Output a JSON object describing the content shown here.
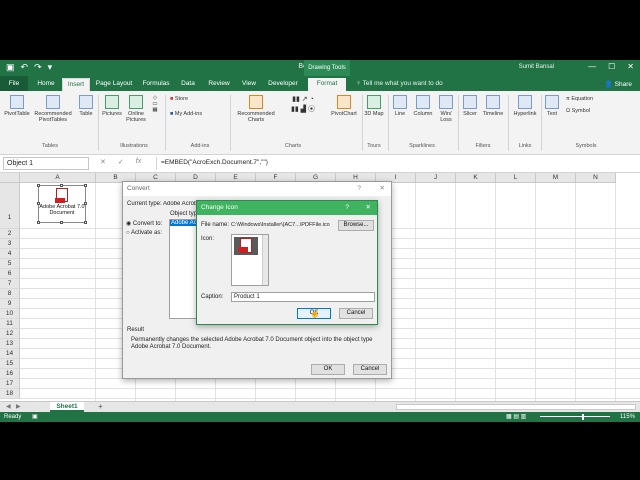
{
  "window": {
    "title": "Book1 - Excel",
    "drawing_tools": "Drawing Tools",
    "user": "Sumit Bansal",
    "controls": [
      "—",
      "☐",
      "✕"
    ]
  },
  "tabs": {
    "file": "File",
    "home": "Home",
    "insert": "Insert",
    "page_layout": "Page Layout",
    "formulas": "Formulas",
    "data": "Data",
    "review": "Review",
    "view": "View",
    "developer": "Developer",
    "format": "Format",
    "tellme": "Tell me what you want to do",
    "share": "Share"
  },
  "ribbon": {
    "pivottable": "PivotTable",
    "recommended_pivottables": "Recommended PivotTables",
    "table": "Table",
    "tables_group": "Tables",
    "pictures": "Pictures",
    "online_pictures": "Online Pictures",
    "illustrations_group": "Illustrations",
    "store": "Store",
    "my_addins": "My Add-ins",
    "addins_group": "Add-ins",
    "recommended_charts": "Recommended Charts",
    "charts_group": "Charts",
    "pivotchart": "PivotChart",
    "map3d": "3D Map",
    "tours_group": "Tours",
    "line": "Line",
    "column": "Column",
    "winloss": "Win/ Loss",
    "sparklines_group": "Sparklines",
    "slicer": "Slicer",
    "timeline": "Timeline",
    "filters_group": "Filters",
    "hyperlink": "Hyperlink",
    "links_group": "Links",
    "text": "Text",
    "equation": "Equation",
    "symbol": "Symbol",
    "symbols_group": "Symbols"
  },
  "formula_bar": {
    "name_box": "Object 1",
    "cancel": "✕",
    "enter": "✓",
    "fx": "fx",
    "formula": "=EMBED(\"AcroExch.Document.7\",\"\")"
  },
  "grid": {
    "columns": [
      "A",
      "B",
      "C",
      "D",
      "E",
      "F",
      "G",
      "H",
      "I",
      "J",
      "K",
      "L",
      "M",
      "N"
    ],
    "rows": [
      "1",
      "2",
      "3",
      "4",
      "5",
      "6",
      "7",
      "8",
      "9",
      "10",
      "11",
      "12",
      "13",
      "14",
      "15",
      "16",
      "17",
      "18"
    ],
    "embedded_object_label": "Adobe Acrobat 7.0 Document"
  },
  "convert_dialog": {
    "title": "Convert",
    "help": "?",
    "close": "✕",
    "current_type_label": "Current type:",
    "current_type_value": "Adobe Acrobat 7.0 Document",
    "object_type_label": "Object type:",
    "object_type_value": "Adobe Acrobat",
    "convert_to": "Convert to:",
    "activate_as": "Activate as:",
    "result_label": "Result",
    "result_text": "Permanently changes the selected Adobe Acrobat 7.0 Document object into the object type Adobe Acrobat 7.0 Document.",
    "ok": "OK",
    "cancel": "Cancel"
  },
  "change_icon_dialog": {
    "title": "Change Icon",
    "help": "?",
    "close": "✕",
    "file_name_label": "File name:",
    "file_name_value": "C:\\Windows\\Installer\\{AC7...\\PDFFile.ico",
    "browse": "Browse...",
    "icon_label": "Icon:",
    "caption_label": "Caption:",
    "caption_value": "Product 1",
    "ok": "OK",
    "cancel": "Cancel"
  },
  "sheets": {
    "active": "Sheet1",
    "add": "+"
  },
  "status": {
    "ready": "Ready",
    "zoom": "115%"
  }
}
